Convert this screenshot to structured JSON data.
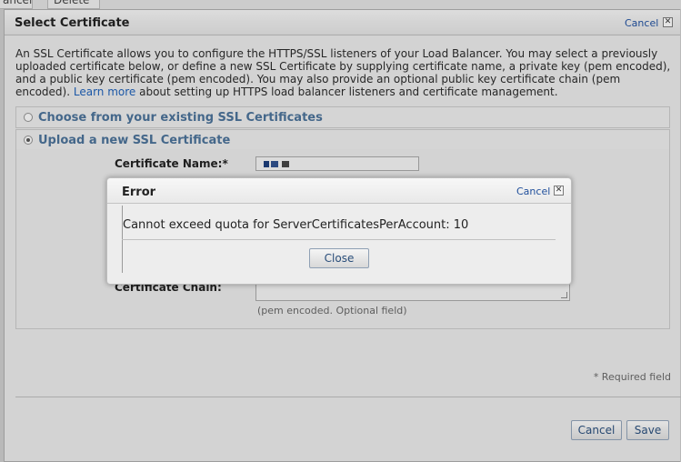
{
  "background_tabs": [
    "ancer",
    "Delete"
  ],
  "dialog": {
    "title": "Select Certificate",
    "cancel_label": "Cancel",
    "close_glyph": "✕",
    "intro_text": "An SSL Certificate allows you to configure the HTTPS/SSL listeners of your Load Balancer. You may select a previously uploaded certificate below, or define a new SSL Certificate by supplying certificate name, a private key (pem encoded), and a public key certificate (pem encoded). You may also provide an optional public key certificate chain (pem encoded). ",
    "learn_more_label": "Learn more",
    "intro_tail": " about setting up HTTPS load balancer listeners and certificate management.",
    "option_existing": "Choose from your existing SSL Certificates",
    "option_upload": "Upload a new SSL Certificate",
    "option_upload_selected": true,
    "cert_name_label": "Certificate Name:*",
    "cert_chain_label": "Certificate Chain:",
    "chain_hint": "(pem encoded. Optional field)",
    "required_note": "* Required field",
    "cancel_button": "Cancel",
    "save_button": "Save"
  },
  "error_dialog": {
    "title": "Error",
    "cancel_label": "Cancel",
    "close_glyph": "✕",
    "message": "Cannot exceed quota for ServerCertificatesPerAccount: 10",
    "close_button": "Close"
  },
  "colors": {
    "link": "#1f5fb4",
    "option_label": "#4a6f95",
    "redacted": "#1d3d78"
  }
}
